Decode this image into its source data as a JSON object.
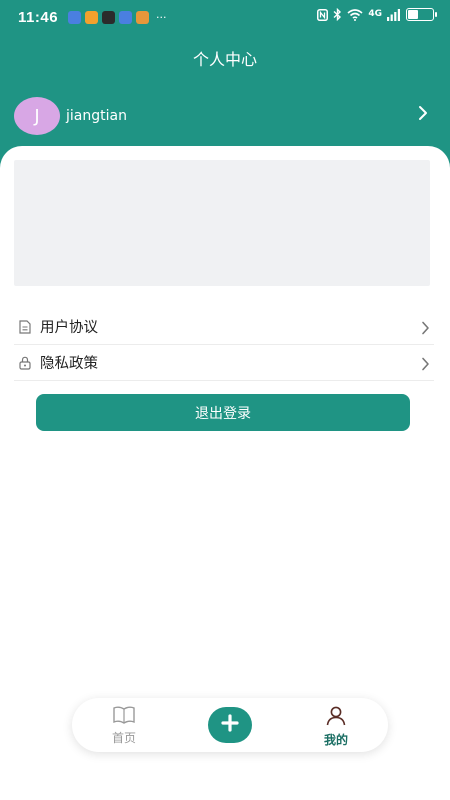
{
  "status_bar": {
    "time": "11:46",
    "more": "···",
    "network_type": "4G",
    "notification_colors": [
      "#4a7fe0",
      "#f2a12d",
      "#2b2b2b",
      "#4a7fe0",
      "#e8973a"
    ]
  },
  "header": {
    "title": "个人中心",
    "background_color": "#1f9484"
  },
  "profile": {
    "avatar_letter": "J",
    "username": "jiangtian",
    "avatar_color": "#d8a7e5"
  },
  "menu": {
    "items": [
      {
        "label": "用户协议",
        "icon": "document-icon"
      },
      {
        "label": "隐私政策",
        "icon": "lock-icon"
      }
    ]
  },
  "logout": {
    "label": "退出登录"
  },
  "bottom_nav": {
    "home_label": "首页",
    "mine_label": "我的",
    "add_icon": "plus-icon",
    "accent_color": "#1f9484"
  }
}
